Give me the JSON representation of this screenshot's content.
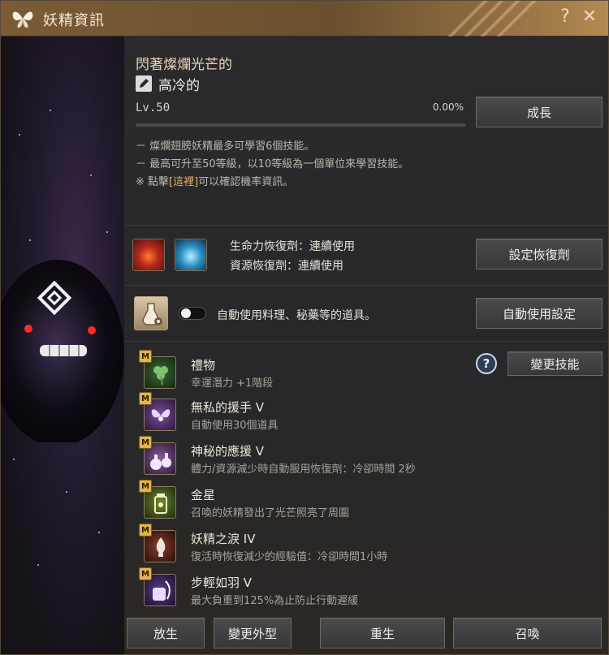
{
  "window": {
    "title": "妖精資訊",
    "help_glyph": "?",
    "close_glyph": "✕"
  },
  "fairy": {
    "title_line": "閃著燦爛光芒的",
    "name": "高冷的",
    "level_text": "Lv.50",
    "exp_percent_text": "0.00%",
    "exp_fraction": 0.0
  },
  "buttons": {
    "grow": "成長",
    "set_potion": "設定恢復劑",
    "auto_use_settings": "自動使用設定",
    "change_skill": "變更技能",
    "release": "放生",
    "change_appearance": "變更外型",
    "rebirth": "重生",
    "summon": "召喚"
  },
  "info": {
    "line1": "－ 燦爛翅膀妖精最多可學習6個技能。",
    "line2": "－ 最高可升至50等級，以10等級為一個單位來學習技能。",
    "line3_prefix": "※ 點擊",
    "line3_link": "[這裡]",
    "line3_suffix": "可以確認機率資訊。"
  },
  "potions": {
    "hp": "生命力恢復劑：連續使用",
    "resource": "資源恢復劑：連續使用"
  },
  "auto_use": {
    "label": "自動使用料理、秘藥等的道具。",
    "enabled": false
  },
  "skills": [
    {
      "badge": "M",
      "name": "禮物",
      "desc": "幸運潛力 +1階段",
      "icon": "clover-icon"
    },
    {
      "badge": "M",
      "name": "無私的援手 V",
      "desc": "自動使用30個道具",
      "icon": "fairy-icon"
    },
    {
      "badge": "M",
      "name": "神秘的應援 V",
      "desc": "體力/資源減少時自動服用恢復劑：冷卻時間 2秒",
      "icon": "potion-bottles-icon"
    },
    {
      "badge": "M",
      "name": "金星",
      "desc": "召喚的妖精發出了光芒照亮了周圍",
      "icon": "lantern-icon"
    },
    {
      "badge": "M",
      "name": "妖精之淚 IV",
      "desc": "復活時恢復減少的經驗值：冷卻時間1小時",
      "icon": "tear-vial-icon"
    },
    {
      "badge": "M",
      "name": "步輕如羽 V",
      "desc": "最大負重到125%為止防止行動遲緩",
      "icon": "feather-bag-icon"
    }
  ],
  "colors": {
    "titlebar": "#7a5b35",
    "accent_link": "#e3b561",
    "exp_fill": "#e4c27e"
  }
}
